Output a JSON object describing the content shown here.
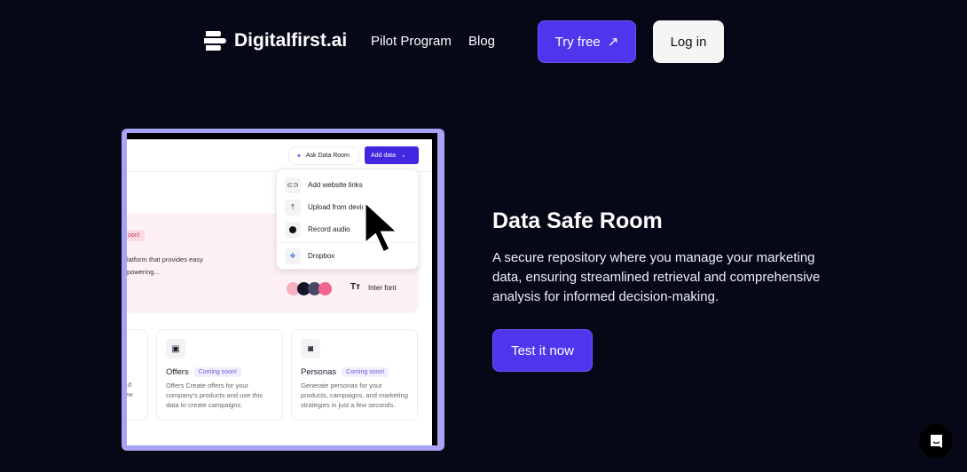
{
  "header": {
    "brand": "Digitalfirst.ai",
    "nav": [
      "Pilot Program",
      "Blog"
    ],
    "try_free": "Try free",
    "try_free_icon": "arrow-up-right-icon",
    "login": "Log in"
  },
  "colors": {
    "background": "#060818",
    "accent": "#4f35ec",
    "frame": "#a9a3f4"
  },
  "preview": {
    "ask_button": "Ask Data Room",
    "add_button": "Add data",
    "menu": [
      {
        "label": "Add website links",
        "icon": "link-icon"
      },
      {
        "label": "Upload from device",
        "icon": "upload-icon"
      },
      {
        "label": "Record audio",
        "icon": "play-icon"
      },
      {
        "label": "Dropbox",
        "icon": "dropbox-icon"
      }
    ],
    "banner_badge": "oon!",
    "banner_text1": "latform that provides easy",
    "banner_text2": "powering...",
    "font_label": "Inter font",
    "cards": [
      {
        "title": "Offers",
        "badge": "Coming soon!",
        "text": "Offers Create offers for your company's products and use this data to create campaigns."
      },
      {
        "title": "Personas",
        "badge": "Coming soon!",
        "text": "Generate personas for your products, campaigns, and marketing strategies in just a few seconds."
      }
    ],
    "left_card_text1": "d",
    "left_card_text2": "few"
  },
  "hero": {
    "title": "Data Safe Room",
    "description": "A secure repository where you manage your marketing data, ensuring streamlined retrieval and comprehensive analysis for informed decision-making.",
    "cta": "Test it now"
  }
}
